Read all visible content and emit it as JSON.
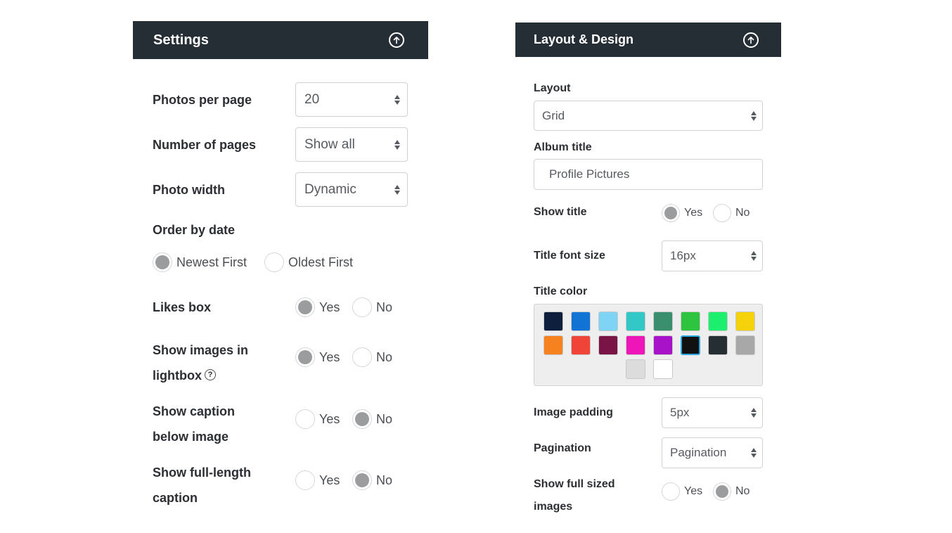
{
  "settings": {
    "title": "Settings",
    "photos_per_page": {
      "label": "Photos per page",
      "value": "20"
    },
    "number_of_pages": {
      "label": "Number of pages",
      "value": "Show all"
    },
    "photo_width": {
      "label": "Photo width",
      "value": "Dynamic"
    },
    "order_by_date": {
      "label": "Order by date",
      "options": [
        "Newest First",
        "Oldest First"
      ],
      "selected": "Newest First"
    },
    "likes_box": {
      "label": "Likes box",
      "options": [
        "Yes",
        "No"
      ],
      "selected": "Yes"
    },
    "show_images_lightbox": {
      "label_line1": "Show images in",
      "label_line2": "lightbox",
      "help_icon": "question-circle-icon",
      "options": [
        "Yes",
        "No"
      ],
      "selected": "Yes"
    },
    "show_caption_below": {
      "label_line1": "Show caption",
      "label_line2": "below image",
      "options": [
        "Yes",
        "No"
      ],
      "selected": "No"
    },
    "show_full_caption": {
      "label_line1": "Show full-length",
      "label_line2": "caption",
      "options": [
        "Yes",
        "No"
      ],
      "selected": "No"
    }
  },
  "layout_design": {
    "title": "Layout & Design",
    "layout": {
      "label": "Layout",
      "value": "Grid"
    },
    "album_title": {
      "label": "Album title",
      "value": "Profile Pictures"
    },
    "show_title": {
      "label": "Show title",
      "options": [
        "Yes",
        "No"
      ],
      "selected": "Yes"
    },
    "title_font_size": {
      "label": "Title font size",
      "value": "16px"
    },
    "title_color": {
      "label": "Title color",
      "swatches": [
        "#0d1f3c",
        "#1173d4",
        "#7fd3f5",
        "#33c8c8",
        "#3a8f6e",
        "#2fc43f",
        "#1cee6e",
        "#f5d20a",
        "#f5821f",
        "#f04438",
        "#7a1446",
        "#ee16b8",
        "#a812c8",
        "#111111",
        "#252e33",
        "#a8a8a8",
        "#dcdcdc",
        "#ffffff"
      ],
      "selected_index": 13
    },
    "image_padding": {
      "label": "Image padding",
      "value": "5px"
    },
    "pagination": {
      "label": "Pagination",
      "value": "Pagination"
    },
    "show_full_sized": {
      "label_line1": "Show full sized",
      "label_line2": "images",
      "options": [
        "Yes",
        "No"
      ],
      "selected": "No"
    }
  },
  "icons": {
    "collapse": "arrow-up-circle-icon"
  },
  "colors": {
    "header_bg": "#262e35",
    "radio_fill": "#9a9c9e",
    "selected_swatch_border": "#2aa7e0"
  }
}
